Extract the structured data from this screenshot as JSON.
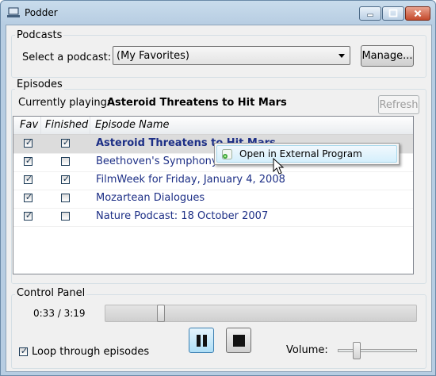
{
  "window": {
    "title": "Podder"
  },
  "podcasts": {
    "group_label": "Podcasts",
    "select_label": "Select a podcast:",
    "selected": "(My Favorites)",
    "manage_label": "Manage..."
  },
  "episodes": {
    "group_label": "Episodes",
    "now_playing_prefix": "Currently playing:",
    "now_playing_title": "Asteroid Threatens to Hit Mars",
    "refresh_label": "Refresh",
    "columns": {
      "fav": "Fav",
      "finished": "Finished",
      "name": "Episode Name"
    },
    "rows": [
      {
        "fav": true,
        "finished": true,
        "name": "Asteroid Threatens to Hit Mars",
        "selected": true
      },
      {
        "fav": true,
        "finished": false,
        "name": "Beethoven's Symphony No. 9",
        "selected": false
      },
      {
        "fav": true,
        "finished": true,
        "name": "FilmWeek for Friday, January 4, 2008",
        "selected": false
      },
      {
        "fav": true,
        "finished": false,
        "name": "Mozartean Dialogues",
        "selected": false
      },
      {
        "fav": true,
        "finished": false,
        "name": "Nature Podcast: 18 October 2007",
        "selected": false
      }
    ],
    "context_menu": {
      "item": "Open in External Program"
    }
  },
  "control_panel": {
    "group_label": "Control Panel",
    "time": "0:33 / 3:19",
    "progress": 0.17,
    "loop_label": "Loop through episodes",
    "loop_checked": true,
    "volume_label": "Volume:",
    "volume": 0.2
  },
  "colors": {
    "link": "#1d2f86",
    "accent": "#3c7fb1"
  },
  "icons": {
    "app": "monitor-icon",
    "context": "external-program-icon",
    "play_state": "pause-icon",
    "stop": "stop-icon"
  }
}
